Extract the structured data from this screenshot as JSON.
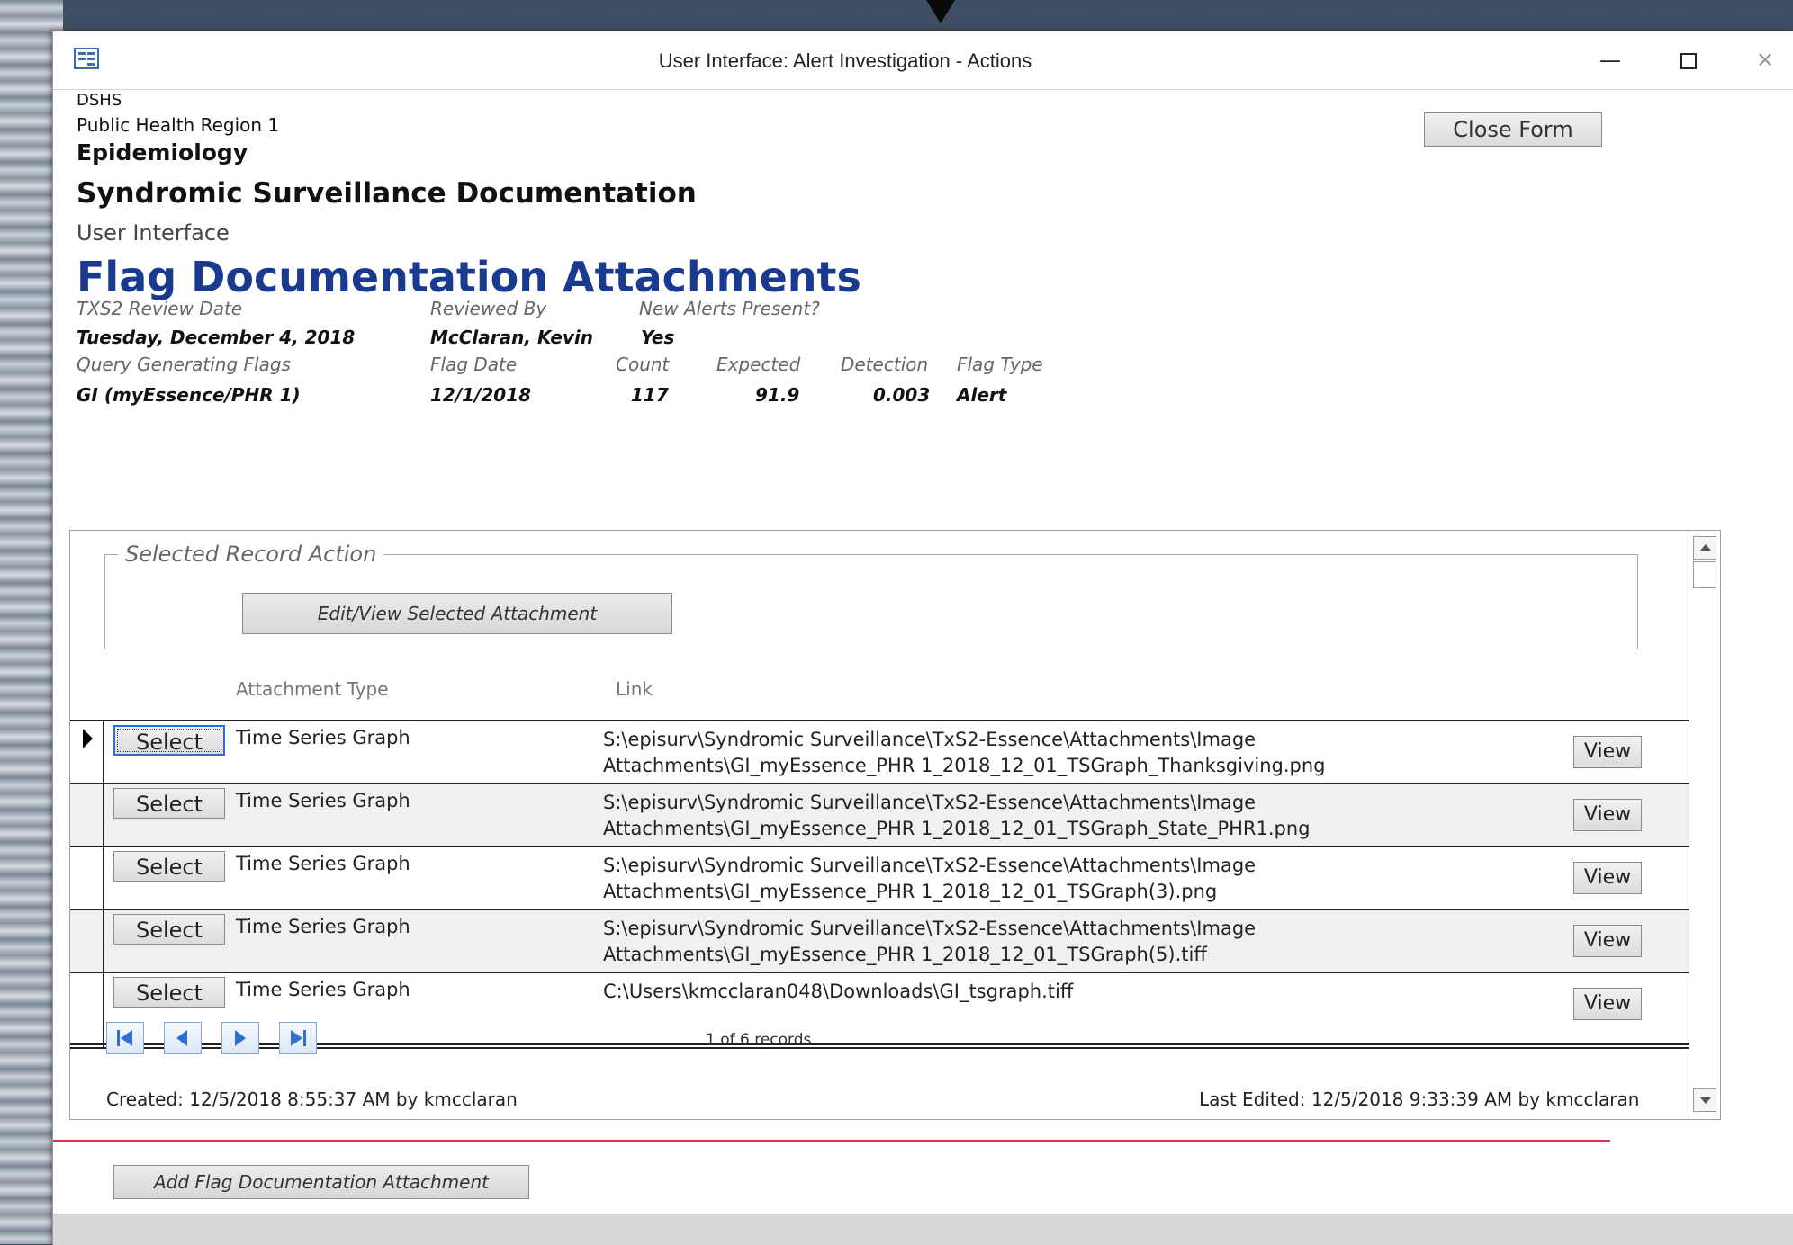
{
  "window": {
    "title": "User Interface: Alert Investigation - Actions",
    "minimize_glyph": "—",
    "close_glyph": "✕"
  },
  "header": {
    "org_line1": "DSHS",
    "org_line2": "Public Health Region 1",
    "department": "Epidemiology",
    "system": "Syndromic Surveillance Documentation",
    "section": "User Interface",
    "form_title": "Flag Documentation Attachments",
    "close_form_label": "Close Form"
  },
  "summary": {
    "review_date_label": "TXS2 Review Date",
    "review_date_value": "Tuesday, December 4, 2018",
    "reviewed_by_label": "Reviewed By",
    "reviewed_by_value": "McClaran, Kevin",
    "new_alerts_label": "New Alerts Present?",
    "new_alerts_value": "Yes",
    "query_label": "Query Generating Flags",
    "query_value": "GI (myEssence/PHR 1)",
    "flag_date_label": "Flag Date",
    "flag_date_value": "12/1/2018",
    "count_label": "Count",
    "count_value": "117",
    "expected_label": "Expected",
    "expected_value": "91.9",
    "detection_label": "Detection",
    "detection_value": "0.003",
    "flag_type_label": "Flag Type",
    "flag_type_value": "Alert"
  },
  "subform": {
    "action_group_label": "Selected Record Action",
    "edit_view_label": "Edit/View Selected Attachment",
    "col_attachment_type": "Attachment Type",
    "col_link": "Link",
    "select_label": "Select",
    "view_label": "View",
    "rows": [
      {
        "type": "Time Series Graph",
        "link_line1": "S:\\episurv\\Syndromic Surveillance\\TxS2-Essence\\Attachments\\Image",
        "link_line2": "Attachments\\GI_myEssence_PHR 1_2018_12_01_TSGraph_Thanksgiving.png"
      },
      {
        "type": "Time Series Graph",
        "link_line1": "S:\\episurv\\Syndromic Surveillance\\TxS2-Essence\\Attachments\\Image",
        "link_line2": "Attachments\\GI_myEssence_PHR 1_2018_12_01_TSGraph_State_PHR1.png"
      },
      {
        "type": "Time Series Graph",
        "link_line1": "S:\\episurv\\Syndromic Surveillance\\TxS2-Essence\\Attachments\\Image",
        "link_line2": "Attachments\\GI_myEssence_PHR 1_2018_12_01_TSGraph(3).png"
      },
      {
        "type": "Time Series Graph",
        "link_line1": "S:\\episurv\\Syndromic Surveillance\\TxS2-Essence\\Attachments\\Image",
        "link_line2": "Attachments\\GI_myEssence_PHR 1_2018_12_01_TSGraph(5).tiff"
      },
      {
        "type": "Time Series Graph",
        "link_line1": "C:\\Users\\kmcclaran048\\Downloads\\GI_tsgraph.tiff",
        "link_line2": ""
      }
    ],
    "record_count": "1 of 6 records",
    "created": "Created: 12/5/2018 8:55:37 AM by kmcclaran",
    "last_edited": "Last Edited: 12/5/2018 9:33:39 AM by kmcclaran"
  },
  "footer": {
    "add_attachment_label": "Add Flag Documentation Attachment"
  },
  "icons": {
    "app": "form-icon",
    "nav_first": "first-record-icon",
    "nav_prev": "previous-record-icon",
    "nav_next": "next-record-icon",
    "nav_last": "last-record-icon"
  },
  "colors": {
    "title_blue": "#1a3a8f",
    "accent_red": "#d9343f"
  }
}
